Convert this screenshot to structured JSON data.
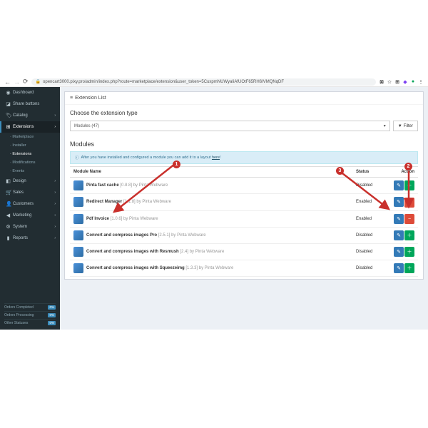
{
  "browser": {
    "url": "opencart3000.pixy.pro/admin/index.php?route=marketplace/extension&user_token=5CuxpmNUWyaIiAfUOtF65RH6IVMQNqDF"
  },
  "sidebar": {
    "items": [
      {
        "icon": "◉",
        "label": "Dashboard"
      },
      {
        "icon": "◪",
        "label": "Share buttons"
      },
      {
        "icon": "🏷",
        "label": "Catalog",
        "chev": true
      },
      {
        "icon": "⊞",
        "label": "Extensions",
        "chev": true,
        "active": true
      }
    ],
    "subs": [
      {
        "label": "Marketplace"
      },
      {
        "label": "Installer"
      },
      {
        "label": "Extensions",
        "active": true
      },
      {
        "label": "Modifications"
      },
      {
        "label": "Events"
      }
    ],
    "items2": [
      {
        "icon": "◧",
        "label": "Design",
        "chev": true
      },
      {
        "icon": "🛒",
        "label": "Sales",
        "chev": true
      },
      {
        "icon": "👤",
        "label": "Customers",
        "chev": true
      },
      {
        "icon": "◀",
        "label": "Marketing",
        "chev": true
      },
      {
        "icon": "⚙",
        "label": "System",
        "chev": true
      },
      {
        "icon": "▮",
        "label": "Reports",
        "chev": true
      }
    ],
    "stats": [
      {
        "label": "Orders Completed",
        "pct": "0%"
      },
      {
        "label": "Orders Processing",
        "pct": "0%"
      },
      {
        "label": "Other Statuses",
        "pct": "0%"
      }
    ]
  },
  "panel": {
    "title": "Extension List"
  },
  "choose": {
    "label": "Choose the extension type",
    "select": "Modules (47)",
    "filter": "Filter"
  },
  "mods": {
    "heading": "Modules",
    "info_pre": "After you have installed and configured a module you can add it to a layout ",
    "info_link": "here",
    "info_post": "!"
  },
  "th": {
    "name": "Module Name",
    "status": "Status",
    "action": "Action"
  },
  "rows": [
    {
      "name": "Pinta fast cache",
      "ver": "[0.8.8] by Pinta Webware",
      "status": "Disabled",
      "b1": "edit",
      "b2": "add"
    },
    {
      "name": "Redirect Manager",
      "ver": "[1.1.8] by Pinta Webware",
      "status": "Enabled",
      "b1": "edit",
      "b2": "del"
    },
    {
      "name": "Pdf Invoice",
      "ver": "[1.0.6] by Pinta Webware",
      "status": "Enabled",
      "b1": "edit",
      "b2": "del"
    },
    {
      "name": "Convert and compress images Pro",
      "ver": "[2.5.1] by Pinta Webware",
      "status": "Disabled",
      "b1": "edit",
      "b2": "add"
    },
    {
      "name": "Convert and compress images with Resmush",
      "ver": "[2.4] by Pinta Webware",
      "status": "Disabled",
      "b1": "edit",
      "b2": "add"
    },
    {
      "name": "Convert and compress images with Squeezeimg",
      "ver": "[1.3.3] by Pinta Webware",
      "status": "Disabled",
      "b1": "edit",
      "b2": "add"
    }
  ]
}
